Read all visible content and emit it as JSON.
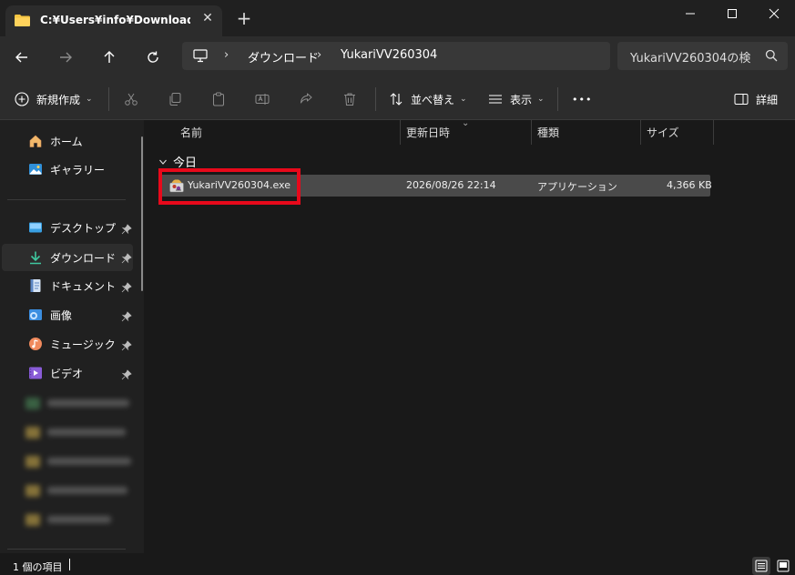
{
  "window": {
    "tab_title": "C:¥Users¥info¥Downloads¥Yuk",
    "tab_close": "✕",
    "new_tab": "+"
  },
  "address": {
    "crumbs": [
      "ダウンロード",
      "YukariVV260304"
    ],
    "separator": "›",
    "search_placeholder": "YukariVV260304の検"
  },
  "toolbar": {
    "new_label": "新規作成",
    "sort_label": "並べ替え",
    "view_label": "表示",
    "more_label": "•••",
    "details_label": "詳細"
  },
  "sidebar": {
    "home": "ホーム",
    "gallery": "ギャラリー",
    "desktop": "デスクトップ",
    "downloads": "ダウンロード",
    "documents": "ドキュメント",
    "pictures": "画像",
    "music": "ミュージック",
    "videos": "ビデオ"
  },
  "columns": {
    "name": "名前",
    "modified": "更新日時",
    "type": "種類",
    "size": "サイズ"
  },
  "group": {
    "label": "今日"
  },
  "files": [
    {
      "name": "YukariVV260304.exe",
      "modified": "2026/08/26 22:14",
      "type": "アプリケーション",
      "size": "4,366 KB"
    }
  ],
  "status": {
    "item_count": "1 個の項目"
  },
  "colors": {
    "background": "#191919",
    "chrome": "#2c2c2c",
    "selected_row": "#4a4a4a",
    "highlight_border": "#e8091b"
  }
}
